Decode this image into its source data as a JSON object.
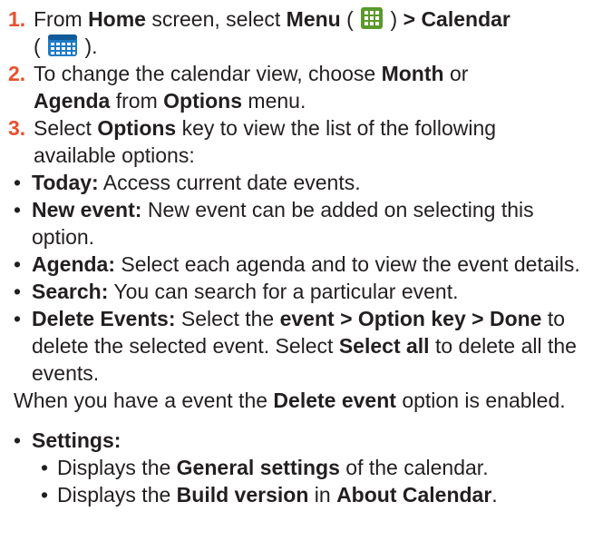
{
  "steps": [
    {
      "number": "1.",
      "parts": {
        "t1": "From ",
        "b1": "Home",
        "t2": " screen, select ",
        "b2": "Menu",
        "t3": " ( ",
        "icon1": "menu-grid-icon",
        "t4": " ) ",
        "b3": "> Calendar",
        "t5": " ( ",
        "icon2": "calendar-app-icon",
        "t6": " )."
      }
    },
    {
      "number": "2.",
      "parts": {
        "t1": "To change the calendar view, choose ",
        "b1": "Month",
        "t2": " or ",
        "b2": "Agenda",
        "t3": " from ",
        "b3": "Options",
        "t4": " menu."
      }
    },
    {
      "number": "3.",
      "parts": {
        "t1": "Select ",
        "b1": "Options",
        "t2": " key to view the list of the following available options:"
      },
      "options": [
        {
          "label": "Today:",
          "desc": " Access current date events."
        },
        {
          "label": "New event:",
          "desc": " New event can be added on selecting this option."
        },
        {
          "label": "Agenda:",
          "desc": " Select each agenda and to view the event details."
        },
        {
          "label": "Search:",
          "desc": " You can search for a particular event."
        }
      ],
      "delete_item": {
        "label": "Delete Events:",
        "t1": " Select the ",
        "b1": "event > Option key > Done",
        "t2": " to delete the selected event. Select ",
        "b2": "Select all",
        "t3": " to delete all the events."
      },
      "note": {
        "t1": "When you have a event the ",
        "b1": "Delete event",
        "t2": " option is enabled."
      },
      "settings": {
        "label": "Settings:",
        "items": [
          {
            "t1": "Displays the ",
            "b1": "General settings",
            "t2": " of the calendar."
          },
          {
            "t1": "Displays the ",
            "b1": "Build version",
            "t2": " in ",
            "b2": "About Calendar",
            "t3": "."
          }
        ]
      }
    }
  ],
  "colors": {
    "step_number": "#e8502e",
    "text": "#231f20",
    "menu_icon_bg": "#5a9a2c",
    "calendar_icon_bg": "#1f7bc4"
  }
}
